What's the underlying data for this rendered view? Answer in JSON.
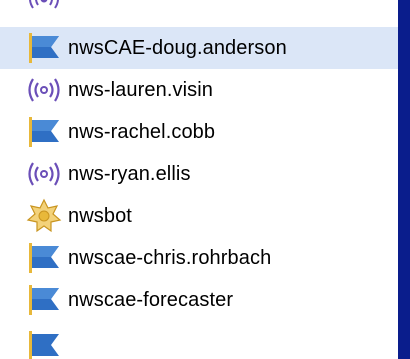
{
  "contacts": [
    {
      "label": "nwsCAE-doug.anderson",
      "icon": "flag-icon",
      "selected": true
    },
    {
      "label": "nws-lauren.visin",
      "icon": "antenna-icon",
      "selected": false
    },
    {
      "label": "nws-rachel.cobb",
      "icon": "flag-icon",
      "selected": false
    },
    {
      "label": "nws-ryan.ellis",
      "icon": "antenna-icon",
      "selected": false
    },
    {
      "label": "nwsbot",
      "icon": "badge-icon",
      "selected": false
    },
    {
      "label": "nwscae-chris.rohrbach",
      "icon": "flag-icon",
      "selected": false
    },
    {
      "label": "nwscae-forecaster",
      "icon": "flag-icon",
      "selected": false
    }
  ],
  "colors": {
    "background": "#0a1d8c",
    "selection": "#dbe6f7",
    "flag_blue": "#2f6fc4",
    "antenna_purple": "#6b4fb8",
    "badge_gold": "#e8b83a"
  }
}
